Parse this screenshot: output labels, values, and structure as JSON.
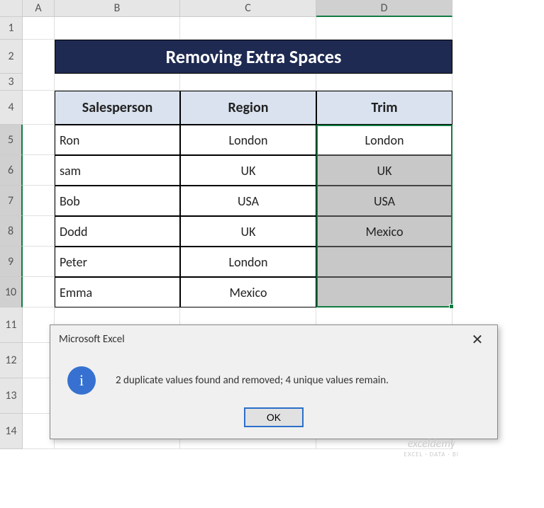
{
  "columns": [
    "A",
    "B",
    "C",
    "D"
  ],
  "rows": [
    "1",
    "2",
    "3",
    "4",
    "5",
    "6",
    "7",
    "8",
    "9",
    "10",
    "11",
    "12",
    "13",
    "14"
  ],
  "active_col": "D",
  "active_rows": [
    "5",
    "6",
    "7",
    "8",
    "9",
    "10"
  ],
  "title": "Removing Extra Spaces",
  "table": {
    "headers": [
      "Salesperson",
      "Region",
      "Trim"
    ],
    "data": [
      {
        "salesperson": "Ron",
        "region": "London",
        "trim": "London",
        "shaded": false
      },
      {
        "salesperson": "sam",
        "region": "UK",
        "trim": "UK",
        "shaded": true
      },
      {
        "salesperson": "Bob",
        "region": "USA",
        "trim": "USA",
        "shaded": true
      },
      {
        "salesperson": "Dodd",
        "region": "UK",
        "trim": "Mexico",
        "shaded": true
      },
      {
        "salesperson": "Peter",
        "region": "London",
        "trim": "",
        "shaded": true
      },
      {
        "salesperson": "Emma",
        "region": "Mexico",
        "trim": "",
        "shaded": true
      }
    ]
  },
  "dialog": {
    "title": "Microsoft Excel",
    "message": "2 duplicate values found and removed; 4 unique values remain.",
    "ok": "OK"
  },
  "watermark": {
    "brand": "exceldemy",
    "tagline": "EXCEL · DATA · BI"
  }
}
